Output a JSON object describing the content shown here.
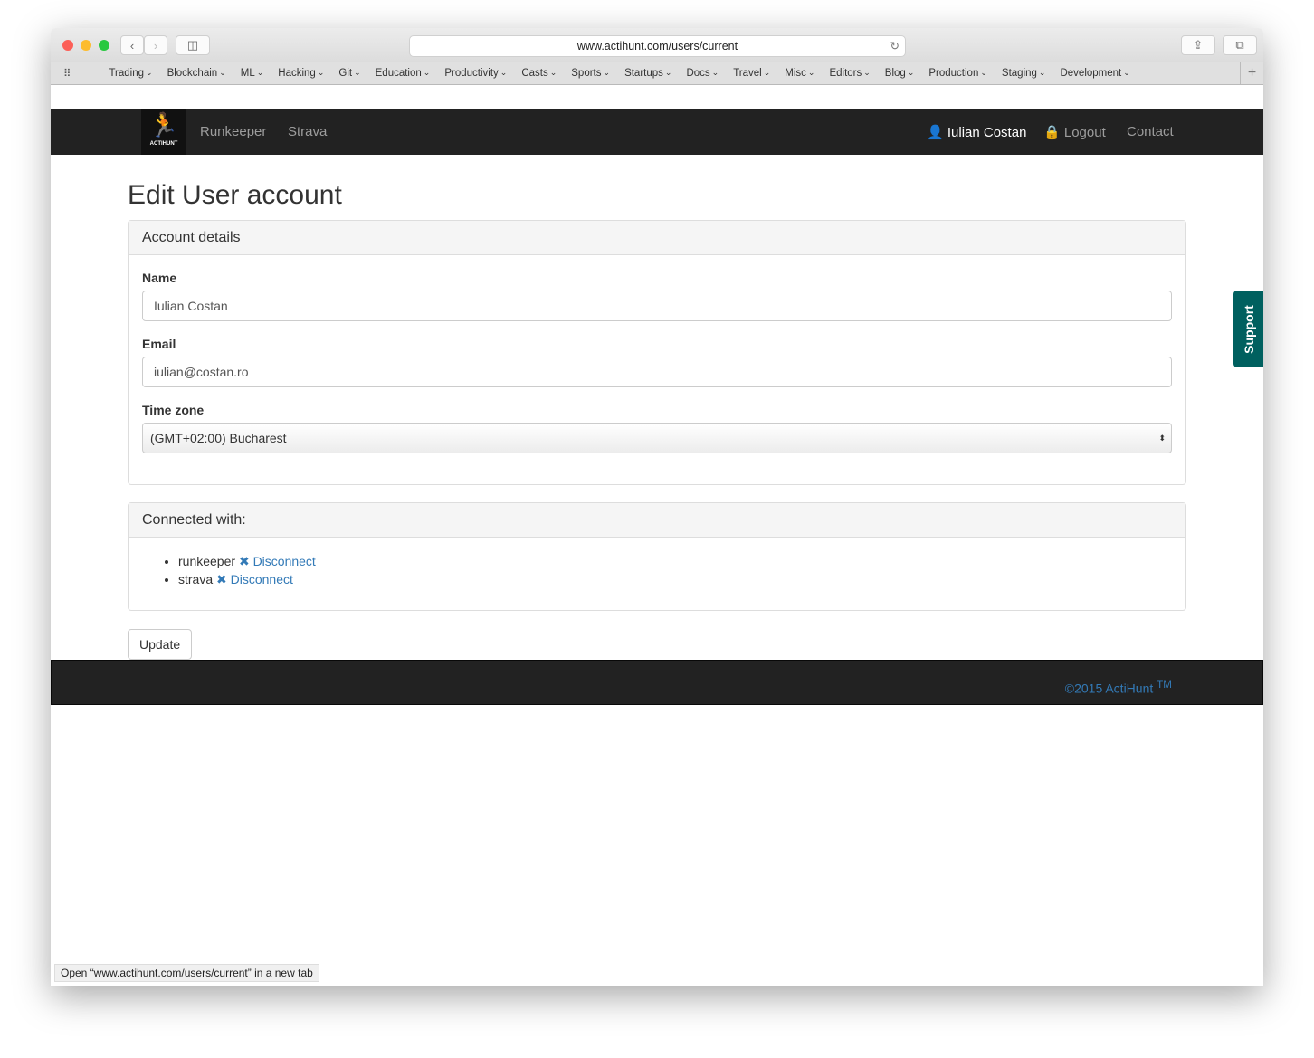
{
  "browser": {
    "url": "www.actihunt.com/users/current",
    "bookmarks": [
      "Trading",
      "Blockchain",
      "ML",
      "Hacking",
      "Git",
      "Education",
      "Productivity",
      "Casts",
      "Sports",
      "Startups",
      "Docs",
      "Travel",
      "Misc",
      "Editors",
      "Blog",
      "Production",
      "Staging",
      "Development"
    ],
    "status": "Open “www.actihunt.com/users/current” in a new tab"
  },
  "nav": {
    "logo_text": "ACTIHUNT",
    "links": [
      "Runkeeper",
      "Strava"
    ],
    "user": "Iulian Costan",
    "logout": "Logout",
    "contact": "Contact"
  },
  "page": {
    "title": "Edit User account",
    "account": {
      "heading": "Account details",
      "name_label": "Name",
      "name": "Iulian Costan",
      "email_label": "Email",
      "email": "iulian@costan.ro",
      "tz_label": "Time zone",
      "tz": "(GMT+02:00) Bucharest"
    },
    "connected": {
      "heading": "Connected with:",
      "items": [
        {
          "service": "runkeeper",
          "action": "Disconnect"
        },
        {
          "service": "strava",
          "action": "Disconnect"
        }
      ]
    },
    "update": "Update"
  },
  "footer": {
    "copyright": "©2015 ActiHunt",
    "tm": "TM"
  },
  "support": "Support"
}
